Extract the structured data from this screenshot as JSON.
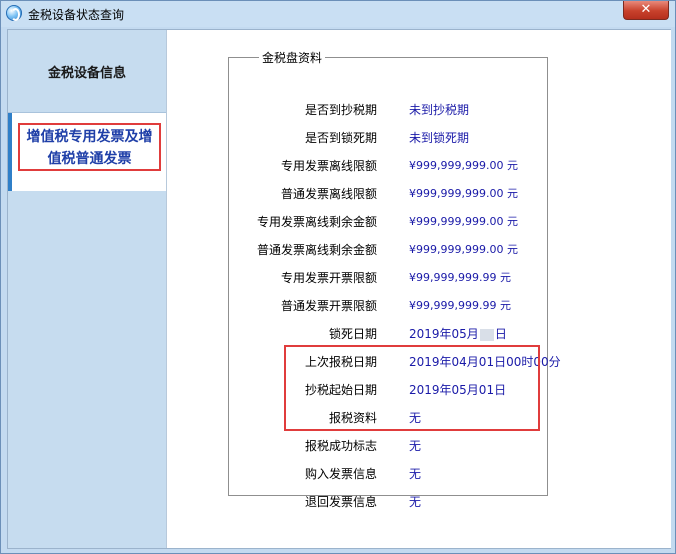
{
  "window": {
    "title": "金税设备状态查询",
    "close_label": "✕"
  },
  "sidebar": {
    "items": [
      {
        "label": "金税设备信息"
      },
      {
        "label": "增值税专用发票及增值税普通发票"
      }
    ]
  },
  "panel": {
    "title": "金税盘资料",
    "rows": [
      {
        "label": "是否到抄税期",
        "value": "未到抄税期"
      },
      {
        "label": "是否到锁死期",
        "value": "未到锁死期"
      },
      {
        "label": "专用发票离线限额",
        "value": "¥999,999,999.00 元"
      },
      {
        "label": "普通发票离线限额",
        "value": "¥999,999,999.00 元"
      },
      {
        "label": "专用发票离线剩余金额",
        "value": "¥999,999,999.00 元"
      },
      {
        "label": "普通发票离线剩余金额",
        "value": "¥999,999,999.00 元"
      },
      {
        "label": "专用发票开票限额",
        "value": "¥99,999,999.99 元"
      },
      {
        "label": "普通发票开票限额",
        "value": "¥99,999,999.99 元"
      },
      {
        "label": "锁死日期",
        "value_prefix": "2019年05月",
        "value_suffix": "日"
      },
      {
        "label": "上次报税日期",
        "value": "2019年04月01日00时00分"
      },
      {
        "label": "抄税起始日期",
        "value": "2019年05月01日"
      },
      {
        "label": "报税资料",
        "value": "无"
      },
      {
        "label": "报税成功标志",
        "value": "无"
      },
      {
        "label": "购入发票信息",
        "value": "无"
      },
      {
        "label": "退回发票信息",
        "value": "无"
      }
    ]
  }
}
